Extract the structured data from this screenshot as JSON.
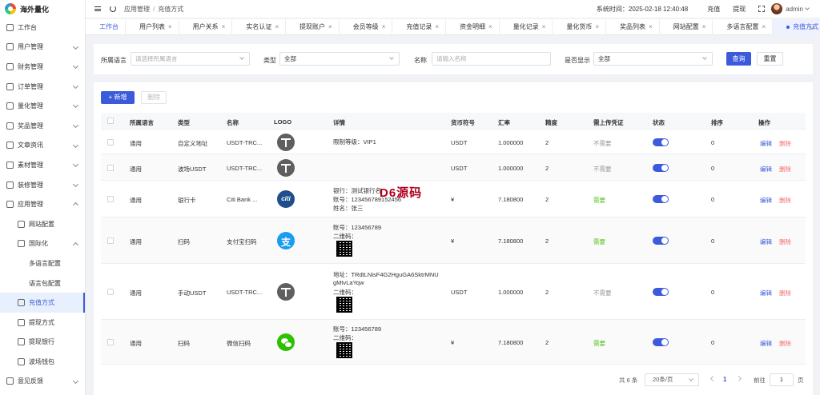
{
  "app": {
    "name": "海外量化"
  },
  "sidebar": {
    "items": [
      {
        "label": "工作台",
        "icon": "monitor-icon"
      },
      {
        "label": "用户管理",
        "icon": "user-icon"
      },
      {
        "label": "财务管理",
        "icon": "chart-icon"
      },
      {
        "label": "订单管理",
        "icon": "order-icon"
      },
      {
        "label": "量化管理",
        "icon": "quant-icon"
      },
      {
        "label": "奖品管理",
        "icon": "gift-icon"
      },
      {
        "label": "文章资讯",
        "icon": "article-icon"
      },
      {
        "label": "素材管理",
        "icon": "image-icon"
      },
      {
        "label": "装修管理",
        "icon": "decor-icon"
      },
      {
        "label": "应用管理",
        "icon": "app-icon"
      },
      {
        "label": "网站配置",
        "icon": "globe-icon"
      },
      {
        "label": "国际化",
        "icon": "globe-icon"
      },
      {
        "label": "多语言配置",
        "icon": ""
      },
      {
        "label": "语言包配置",
        "icon": ""
      },
      {
        "label": "充值方式",
        "icon": "folder-icon"
      },
      {
        "label": "提现方式",
        "icon": "folder-icon"
      },
      {
        "label": "提现银行",
        "icon": "folder-icon"
      },
      {
        "label": "波场钱包",
        "icon": "wallet-icon"
      },
      {
        "label": "意见反馈",
        "icon": "feedback-icon"
      }
    ]
  },
  "header": {
    "breadcrumb": [
      "应用管理",
      "充值方式"
    ],
    "system_time_label": "系统时间：",
    "system_time": "2025-02-18 12:40:48",
    "recharge": "充值",
    "withdraw": "提现",
    "user": "admin"
  },
  "tabs": [
    "工作台",
    "用户列表",
    "用户关系",
    "实名认证",
    "提现账户",
    "会员等级",
    "充值记录",
    "资金明细",
    "量化记录",
    "量化货币",
    "奖品列表",
    "网站配置",
    "多语言配置",
    "充值方式"
  ],
  "filter": {
    "lang_label": "所属语言",
    "lang_placeholder": "请选择所属语言",
    "type_label": "类型",
    "type_value": "全部",
    "name_label": "名称",
    "name_placeholder": "请输入名称",
    "show_label": "是否显示",
    "show_value": "全部",
    "search": "查询",
    "reset": "重置"
  },
  "toolbar": {
    "add": "新增",
    "delete": "删除"
  },
  "table": {
    "columns": [
      "所属语言",
      "类型",
      "名称",
      "LOGO",
      "详情",
      "货币符号",
      "汇率",
      "精度",
      "需上传凭证",
      "状态",
      "排序",
      "操作"
    ],
    "rows": [
      {
        "lang": "通用",
        "type": "自定义地址",
        "name": "USDT-TRC...",
        "logo": "tether-icon",
        "details": [
          "限制等级：VIP1"
        ],
        "qr": false,
        "symbol": "USDT",
        "rate": "1.000000",
        "precision": "2",
        "proof": "不需要",
        "proof_color": "#999999",
        "sort": "0"
      },
      {
        "lang": "通用",
        "type": "波场USDT",
        "name": "USDT-TRC...",
        "logo": "tether-icon",
        "details": [],
        "qr": false,
        "symbol": "USDT",
        "rate": "1.000000",
        "precision": "2",
        "proof": "不需要",
        "proof_color": "#999999",
        "sort": "0"
      },
      {
        "lang": "通用",
        "type": "银行卡",
        "name": "Citi Bank ...",
        "logo": "citibank-icon",
        "details": [
          "银行：测试银行名",
          "账号：123456789152456",
          "姓名：张三"
        ],
        "qr": false,
        "symbol": "¥",
        "rate": "7.180800",
        "precision": "2",
        "proof": "需要",
        "proof_color": "#52c41a",
        "sort": "0"
      },
      {
        "lang": "通用",
        "type": "扫码",
        "name": "支付宝扫码",
        "logo": "alipay-icon",
        "details": [
          "账号：123456789",
          "二维码："
        ],
        "qr": true,
        "symbol": "¥",
        "rate": "7.180800",
        "precision": "2",
        "proof": "需要",
        "proof_color": "#52c41a",
        "sort": "0"
      },
      {
        "lang": "通用",
        "type": "手动USDT",
        "name": "USDT-TRC...",
        "logo": "tether-icon",
        "details": [
          "地址：TRdtLNisF4G2HguGA6SktrMNU",
          "gMtvLaYqw",
          "二维码："
        ],
        "qr": true,
        "symbol": "USDT",
        "rate": "1.000000",
        "precision": "2",
        "proof": "不需要",
        "proof_color": "#999999",
        "sort": "0"
      },
      {
        "lang": "通用",
        "type": "扫码",
        "name": "微信扫码",
        "logo": "wechat-icon",
        "details": [
          "账号：123456789",
          "二维码："
        ],
        "qr": true,
        "symbol": "¥",
        "rate": "7.180800",
        "precision": "2",
        "proof": "需要",
        "proof_color": "#52c41a",
        "sort": "0"
      }
    ],
    "edit": "编辑",
    "delete": "删除"
  },
  "watermark": "D6源码",
  "pagination": {
    "total": "共 6 条",
    "page_size": "20条/页",
    "current": "1",
    "goto_label": "前往",
    "goto_value": "1",
    "page_unit": "页"
  },
  "colors": {
    "primary": "#3b5bdb",
    "danger": "#f56c6c",
    "success": "#52c41a"
  }
}
